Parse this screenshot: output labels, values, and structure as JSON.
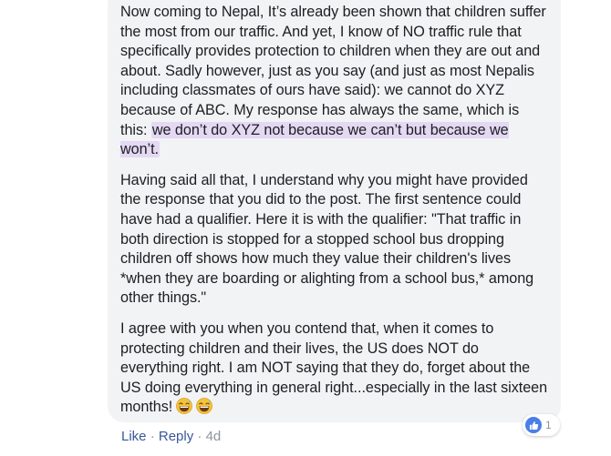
{
  "comment": {
    "p1_before": "Now coming to Nepal, It’s already been shown that children suffer the most from our traffic. And yet, I know of NO traffic rule that specifically provides protection to children when they are out and about. Sadly however, just as you say (and just as most Nepalis including classmates of ours have said): we cannot do XYZ because of ABC. My response has always the same, which is this: ",
    "p1_highlight": "we don’t do XYZ not because we can’t but because we won’t.",
    "p2": "Having said all that, I understand why you might have provided the response that you did to the post. The first sentence could have had a qualifier. Here it is with the qualifier: \"That traffic in both direction is stopped for a stopped school bus dropping children off shows how much they value their children's lives *when they are boarding or alighting from a school bus,* among other things.\"",
    "p3": "I agree with you when you contend that, when it comes to protecting children and their lives, the US does NOT do everything right. I am NOT saying that they do, forget about the US doing everything in general right...especially in the last sixteen months!",
    "emoji_icon": "grinning-sweat-face-icon",
    "highlight_color": "#e4d8f3",
    "bubble_color": "#f2f3f5"
  },
  "actions": {
    "like": "Like",
    "separator": "·",
    "reply": "Reply",
    "time": "4d",
    "link_color": "#385898"
  },
  "reactions": {
    "icon": "thumbs-up-icon",
    "count": "1",
    "color": "#4a7fe6"
  }
}
